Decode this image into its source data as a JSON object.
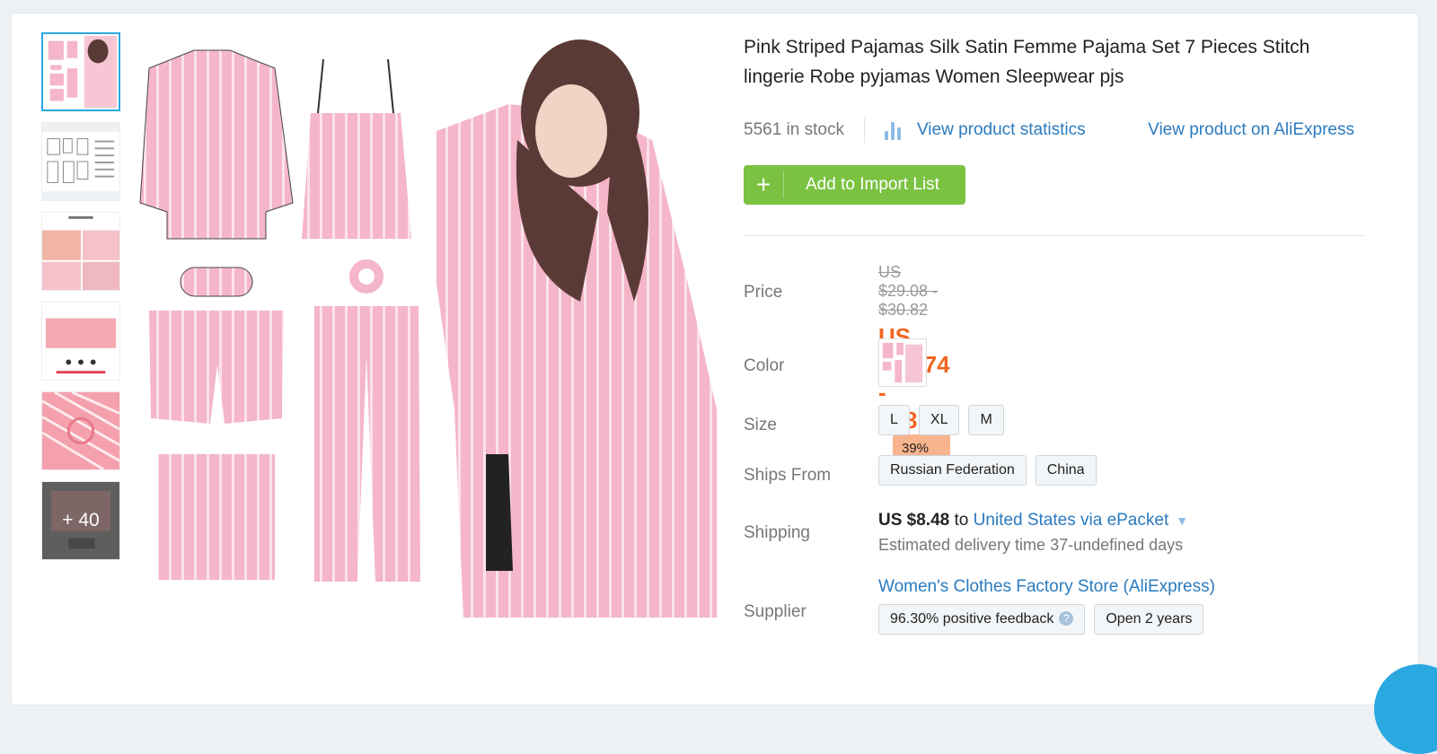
{
  "product": {
    "title": "Pink Striped Pajamas Silk Satin Femme Pajama Set 7 Pieces Stitch lingerie Robe pyjamas Women Sleepwear pjs",
    "stock": "5561 in stock",
    "view_stats": "View product statistics",
    "view_aliexpress": "View product on AliExpress",
    "add_button": "Add to Import List",
    "add_icon": "+"
  },
  "thumbnails": {
    "more_label": "+ 40"
  },
  "price": {
    "label": "Price",
    "original": "US $29.08 - $30.82",
    "current": "US $17.74 - $18.8",
    "discount": "39% off"
  },
  "color": {
    "label": "Color"
  },
  "size": {
    "label": "Size",
    "options": [
      "L",
      "XL",
      "M"
    ]
  },
  "ships_from": {
    "label": "Ships From",
    "options": [
      "Russian Federation",
      "China"
    ]
  },
  "shipping": {
    "label": "Shipping",
    "price": "US $8.48",
    "to_word": "to",
    "destination": "United States via ePacket",
    "estimate": "Estimated delivery time 37-undefined days"
  },
  "supplier": {
    "label": "Supplier",
    "name": "Women's Clothes Factory Store (AliExpress)",
    "feedback": "96.30% positive feedback",
    "help_icon": "?",
    "open": "Open 2 years"
  },
  "colors": {
    "accent_blue": "#2a7bbf",
    "button_green": "#7cc242",
    "price_orange": "#f26522",
    "discount_bg": "#f8b48c",
    "product_pink": "#f4b6c8"
  }
}
